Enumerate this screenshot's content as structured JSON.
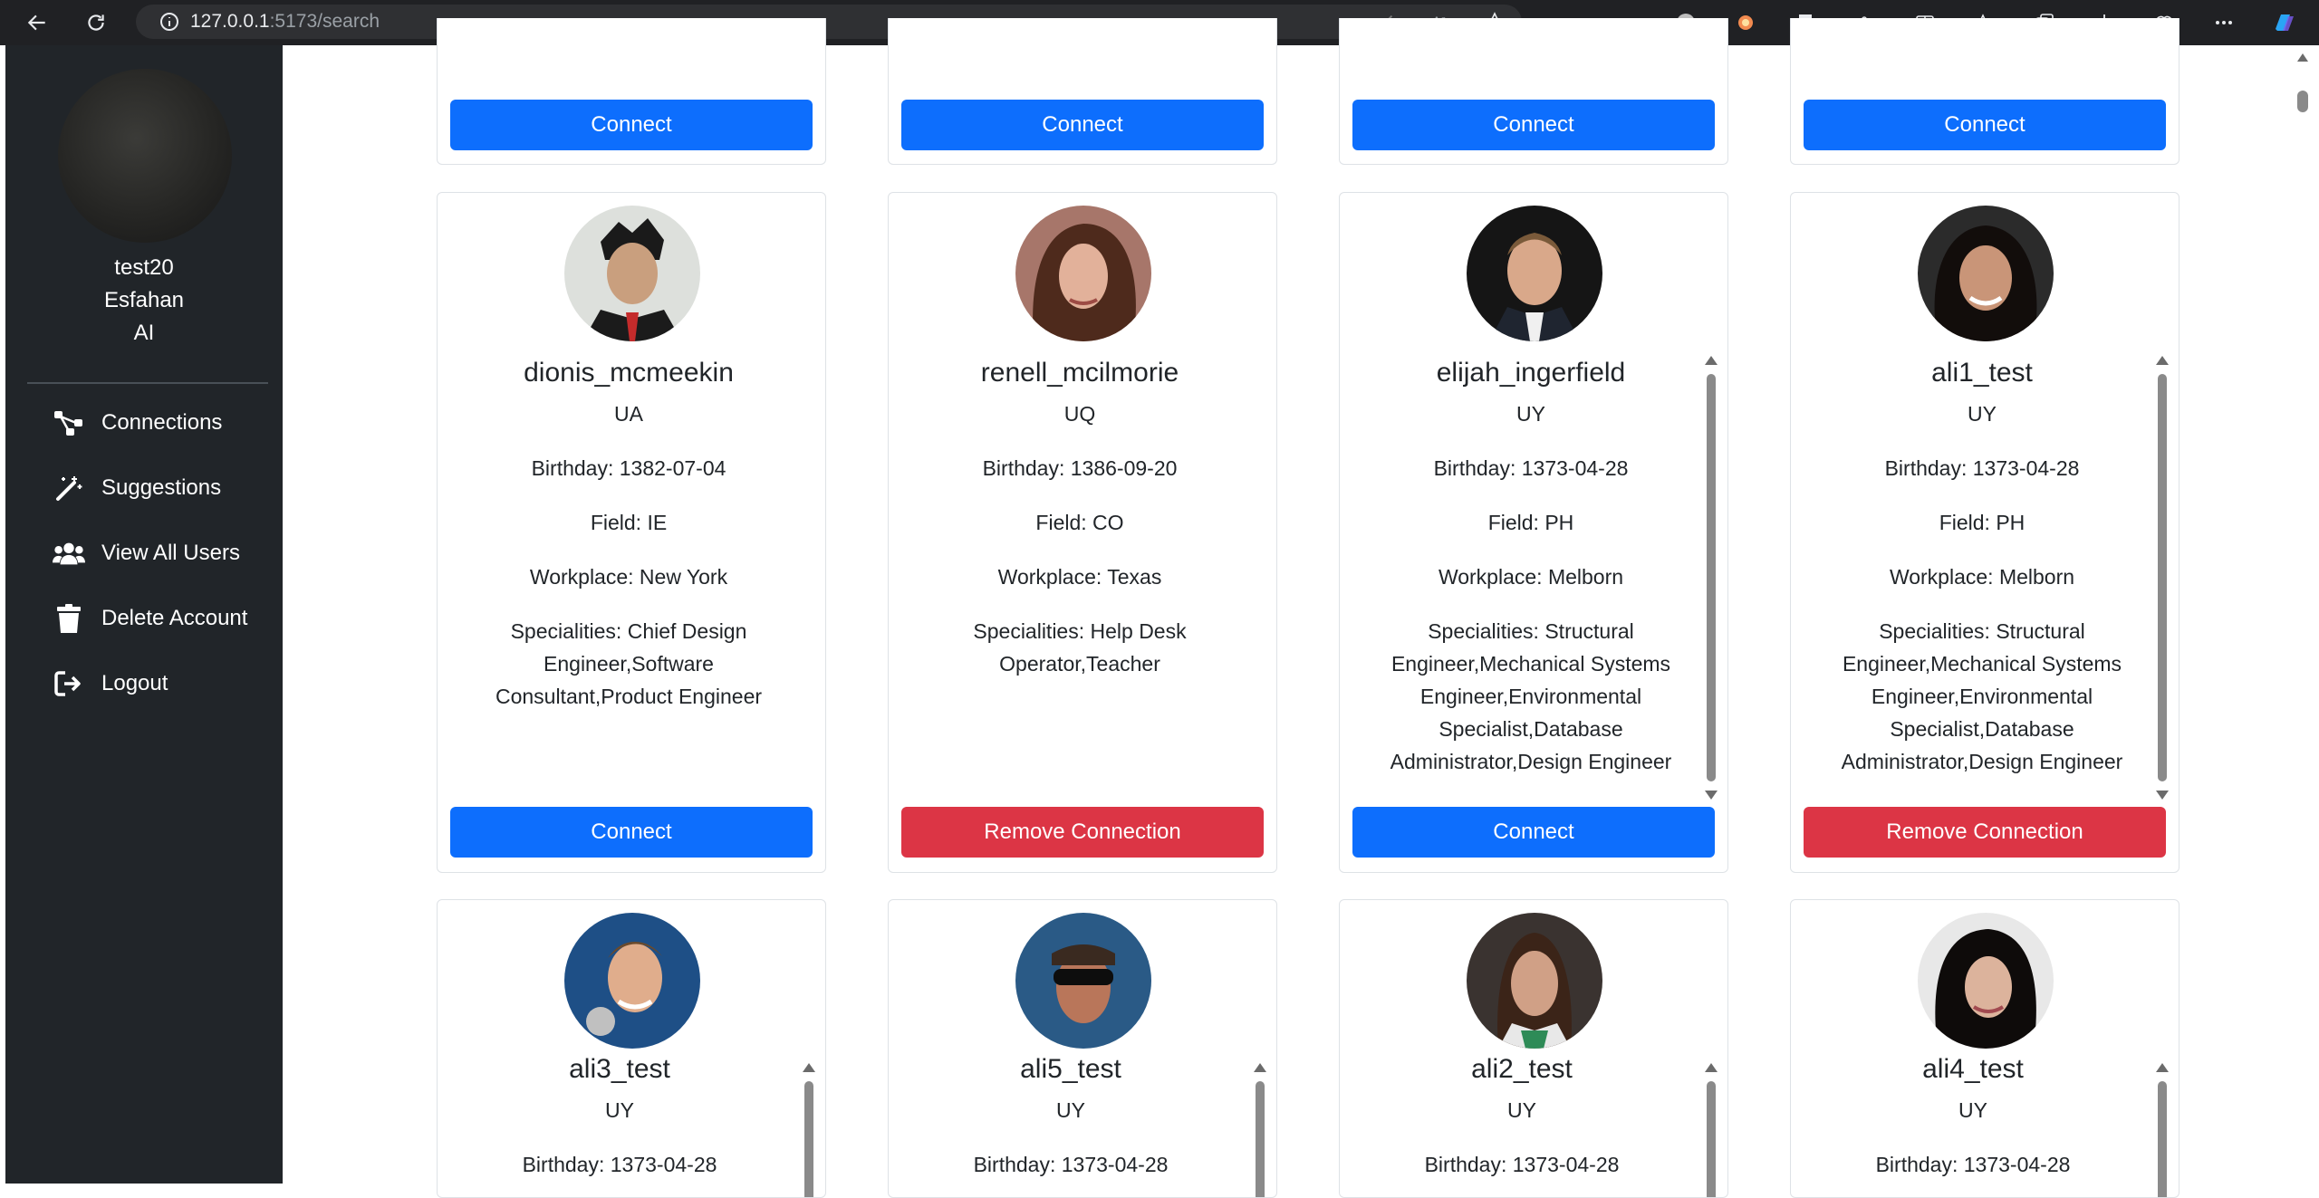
{
  "browser": {
    "url_host": "127.0.0.1",
    "url_rest": ":5173/search"
  },
  "sidebar": {
    "username": "test20",
    "city": "Esfahan",
    "field": "AI",
    "items": [
      {
        "label": "Connections",
        "icon": "connections-icon"
      },
      {
        "label": "Suggestions",
        "icon": "magic-wand-icon"
      },
      {
        "label": "View All Users",
        "icon": "users-icon"
      },
      {
        "label": "Delete Account",
        "icon": "trash-icon"
      },
      {
        "label": "Logout",
        "icon": "logout-icon"
      }
    ]
  },
  "top_row_buttons": [
    "Connect",
    "Connect",
    "Connect",
    "Connect"
  ],
  "cards": [
    {
      "username": "dionis_mcmeekin",
      "country": "UA",
      "birthday": "Birthday: 1382-07-04",
      "field": "Field: IE",
      "workplace": "Workplace: New York",
      "specialities": "Specialities: Chief Design Engineer,Software Consultant,Product Engineer",
      "button": "Connect",
      "button_color": "#0d6efd"
    },
    {
      "username": "renell_mcilmorie",
      "country": "UQ",
      "birthday": "Birthday: 1386-09-20",
      "field": "Field: CO",
      "workplace": "Workplace: Texas",
      "specialities": "Specialities: Help Desk Operator,Teacher",
      "button": "Remove Connection",
      "button_color": "#dc3545"
    },
    {
      "username": "elijah_ingerfield",
      "country": "UY",
      "birthday": "Birthday: 1373-04-28",
      "field": "Field: PH",
      "workplace": "Workplace: Melborn",
      "specialities": "Specialities: Structural Engineer,Mechanical Systems Engineer,Environmental Specialist,Database Administrator,Design Engineer",
      "button": "Connect",
      "button_color": "#0d6efd"
    },
    {
      "username": "ali1_test",
      "country": "UY",
      "birthday": "Birthday: 1373-04-28",
      "field": "Field: PH",
      "workplace": "Workplace: Melborn",
      "specialities": "Specialities: Structural Engineer,Mechanical Systems Engineer,Environmental Specialist,Database Administrator,Design Engineer",
      "button": "Remove Connection",
      "button_color": "#dc3545"
    }
  ],
  "bottom_cards": [
    {
      "username": "ali3_test",
      "country": "UY",
      "birthday": "Birthday: 1373-04-28"
    },
    {
      "username": "ali5_test",
      "country": "UY",
      "birthday": "Birthday: 1373-04-28"
    },
    {
      "username": "ali2_test",
      "country": "UY",
      "birthday": "Birthday: 1373-04-28"
    },
    {
      "username": "ali4_test",
      "country": "UY",
      "birthday": "Birthday: 1373-04-28"
    }
  ]
}
